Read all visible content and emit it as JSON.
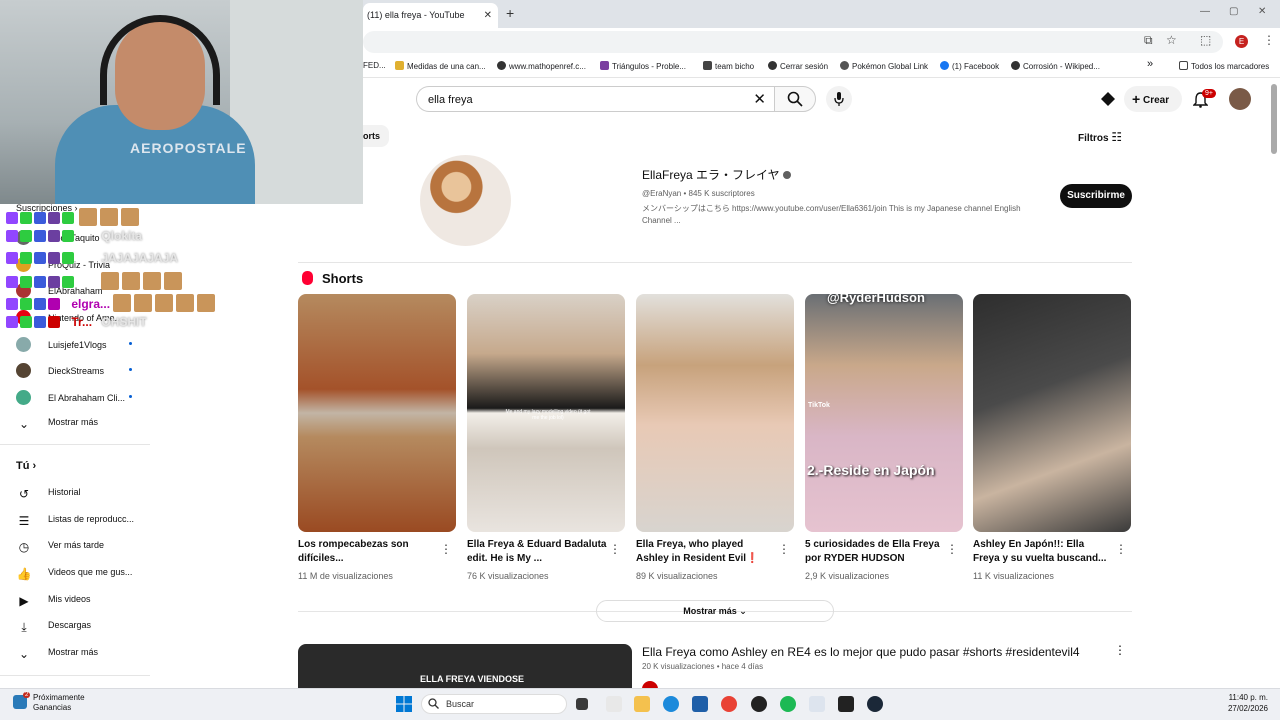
{
  "browser": {
    "tab_title": "(11) ella freya - YouTube",
    "new_tab": "+",
    "bookmarks": [
      "FED...",
      "Medidas de una can...",
      "www.mathopenref.c...",
      "Triángulos - Proble...",
      "team bicho",
      "Cerrar sesión",
      "Pokémon Global Link",
      "(1) Facebook",
      "Corrosión - Wikiped..."
    ],
    "bookmarks_more": "»",
    "all_bookmarks": "Todos los marcadores",
    "profile_initial": "E"
  },
  "youtube": {
    "search_value": "ella freya",
    "create_label": "Crear",
    "notifications_badge": "9+",
    "shorts_chip": "orts",
    "filters_label": "Filtros"
  },
  "channel": {
    "name": "EllaFreya エラ・フレイヤ",
    "handle": "@EraNyan",
    "subscribers": "845 K suscriptores",
    "description": "メンバーシップはこちら https://www.youtube.com/user/Ella6361/join This is my Japanese channel English Channel ...",
    "subscribe_label": "Suscribirme"
  },
  "shorts_section": {
    "title": "Shorts",
    "items": [
      {
        "title": "Los rompecabezas son difíciles...",
        "views": "11 M de visualizaciones"
      },
      {
        "title": "Ella Freya & Eduard Badaluta edit. He is My ...",
        "views": "76 K visualizaciones"
      },
      {
        "title": "Ella Freya, who played Ashley in Resident Evil❗",
        "views": "89 K visualizaciones"
      },
      {
        "title": "5 curiosidades de Ella Freya por RYDER HUDSON",
        "views": "2,9 K visualizaciones"
      },
      {
        "title": "Ashley En Japón!!: Ella Freya y su vuelta buscand...",
        "views": "11 K visualizaciones"
      }
    ],
    "overlay_texts": [
      "@RyderHudson",
      "TikTok",
      "2.-Reside en Japón",
      "Me and my lazy modelling video (it got me the job lol)"
    ],
    "show_more": "Mostrar más"
  },
  "video": {
    "title": "Ella Freya como Ashley en RE4 es lo mejor que pudo pasar #shorts #residentevil4",
    "meta": "20 K visualizaciones • hace 4 días",
    "thumb_text": "ELLA FREYA VIENDOSE"
  },
  "sidebar": {
    "subscriptions_label": "Suscripciones",
    "channels": [
      "MoonTaquito",
      "ProQuiz - Trivia",
      "ElAbrahaham",
      "Nintendo of Ame...",
      "Luisjefe1Vlogs",
      "DieckStreams",
      "El Abrahaham Cli..."
    ],
    "show_more": "Mostrar más",
    "you_label": "Tú",
    "you_items": [
      "Historial",
      "Listas de reproducc...",
      "Ver más tarde",
      "Videos que me gus...",
      "Mis videos",
      "Descargas"
    ],
    "you_show_more": "Mostrar más"
  },
  "chat": [
    {
      "user": "",
      "msg": ""
    },
    {
      "user": "",
      "msg": "Qlokita"
    },
    {
      "user": "",
      "msg": "JAJAJAJAJA"
    },
    {
      "user": "",
      "msg": ""
    },
    {
      "user": "elgra...",
      "msg": ""
    },
    {
      "user": "Tr...",
      "msg": "OHSHIT"
    }
  ],
  "webcam": {
    "shirt_text": "AEROPOSTALE"
  },
  "taskbar": {
    "weather_line1": "Próximamente",
    "weather_line2": "Ganancias",
    "weather_badge": "2",
    "search_placeholder": "Buscar",
    "time": "11:40 p. m.",
    "date": "27/02/2026"
  }
}
